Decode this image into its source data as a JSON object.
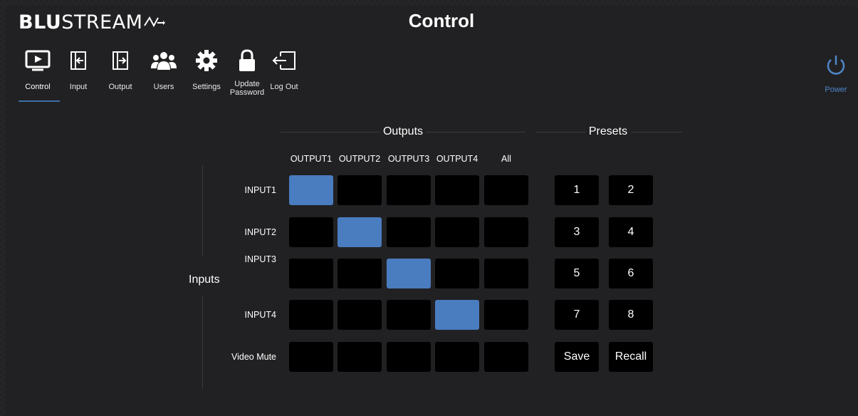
{
  "brand": {
    "logo_bold": "BLU",
    "logo_rest": "STREAM"
  },
  "header": {
    "title": "Control"
  },
  "nav": {
    "items": [
      {
        "label": "Control",
        "icon": "control-icon"
      },
      {
        "label": "Input",
        "icon": "input-icon"
      },
      {
        "label": "Output",
        "icon": "output-icon"
      },
      {
        "label": "Users",
        "icon": "users-icon"
      },
      {
        "label": "Settings",
        "icon": "gear-icon"
      },
      {
        "label": "Update\nPassword",
        "icon": "lock-icon"
      },
      {
        "label": "Log Out",
        "icon": "logout-icon"
      }
    ],
    "active": "Control"
  },
  "power": {
    "label": "Power",
    "icon": "power-icon"
  },
  "matrix": {
    "outputs_title": "Outputs",
    "inputs_title": "Inputs",
    "columns": [
      "OUTPUT1",
      "OUTPUT2",
      "OUTPUT3",
      "OUTPUT4",
      "All"
    ],
    "rows": [
      "INPUT1",
      "INPUT2",
      "INPUT3",
      "INPUT4",
      "Video Mute"
    ],
    "routes": [
      {
        "input": "INPUT1",
        "output": "OUTPUT1"
      },
      {
        "input": "INPUT2",
        "output": "OUTPUT2"
      },
      {
        "input": "INPUT3",
        "output": "OUTPUT3"
      },
      {
        "input": "INPUT4",
        "output": "OUTPUT4"
      }
    ]
  },
  "presets": {
    "title": "Presets",
    "buttons": [
      "1",
      "2",
      "3",
      "4",
      "5",
      "6",
      "7",
      "8",
      "Save",
      "Recall"
    ]
  },
  "colors": {
    "accent": "#4a7cc0",
    "power": "#4d86c8",
    "cell": "#000000",
    "background": "#232325"
  }
}
